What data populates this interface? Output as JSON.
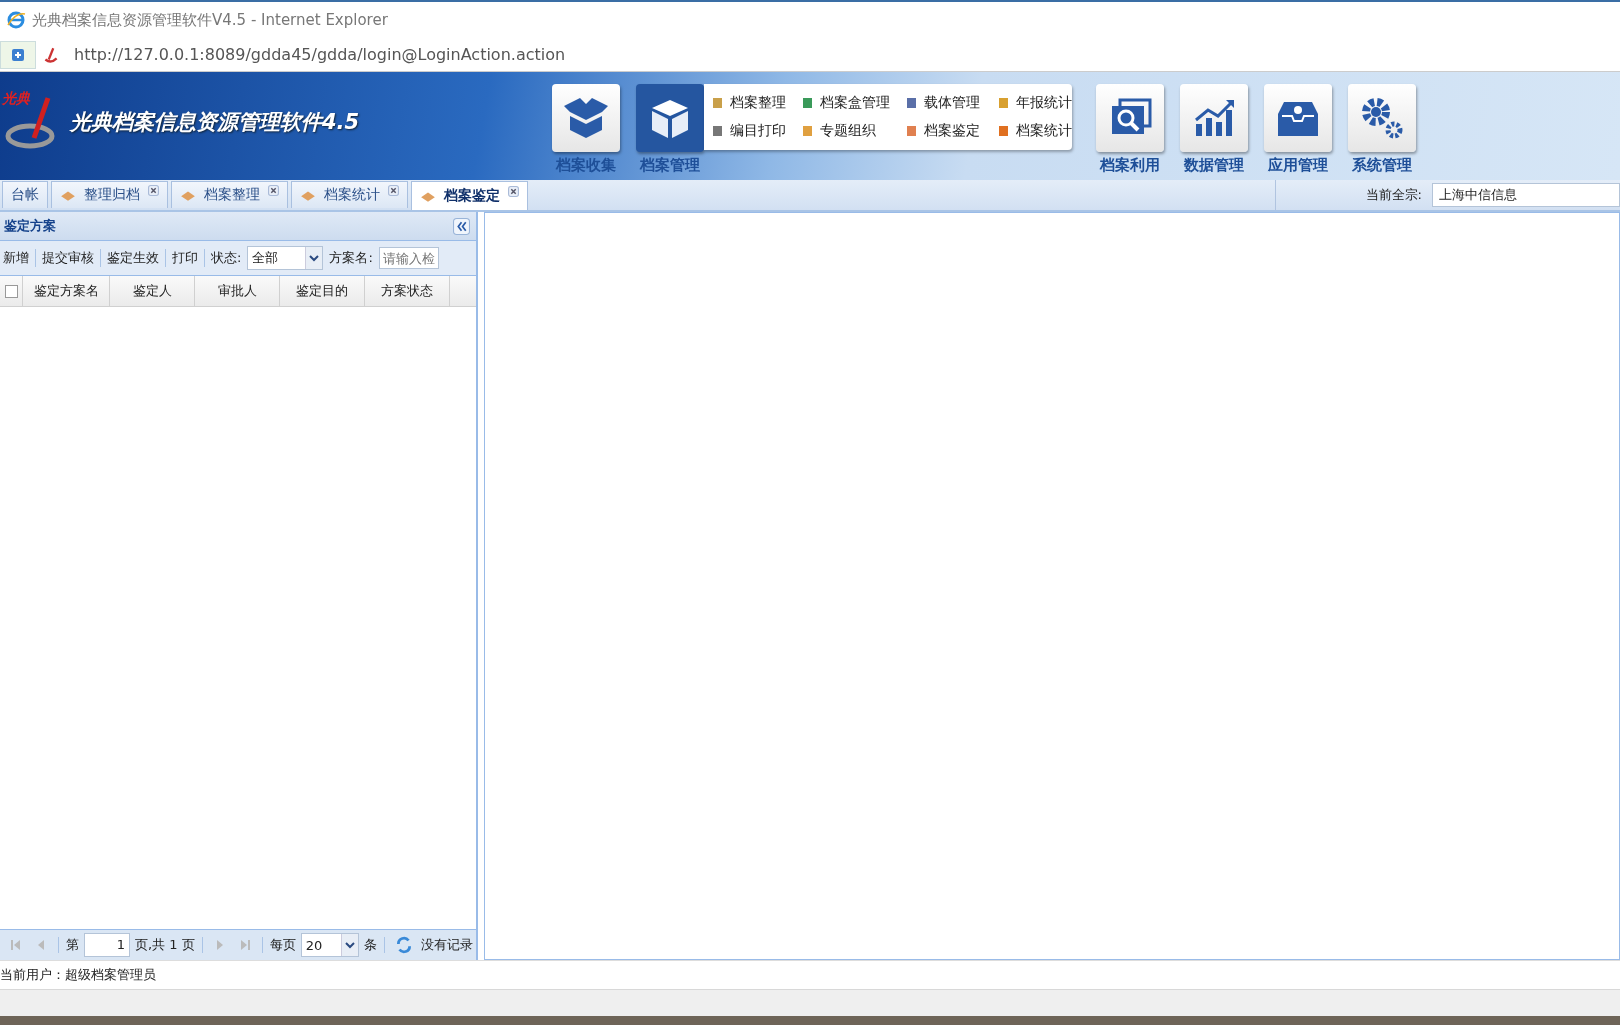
{
  "window": {
    "title": "光典档案信息资源管理软件V4.5 - Internet Explorer"
  },
  "address_bar": {
    "url": "http://127.0.0.1:8089/gdda45/gdda/login@LoginAction.action"
  },
  "header": {
    "logo_text": "光典",
    "app_title": "光典档案信息资源管理软件4.5",
    "modules": [
      {
        "label": "档案收集",
        "selected": false
      },
      {
        "label": "档案管理",
        "selected": true
      },
      {
        "label": "档案利用",
        "selected": false
      },
      {
        "label": "数据管理",
        "selected": false
      },
      {
        "label": "应用管理",
        "selected": false
      },
      {
        "label": "系统管理",
        "selected": false
      }
    ],
    "submenu": [
      {
        "label": "档案整理"
      },
      {
        "label": "档案盒管理"
      },
      {
        "label": "载体管理"
      },
      {
        "label": "年报统计"
      },
      {
        "label": "编目打印"
      },
      {
        "label": "专题组织"
      },
      {
        "label": "档案鉴定"
      },
      {
        "label": "档案统计"
      }
    ]
  },
  "tabs": [
    {
      "label": "台帐",
      "selected": false,
      "closable": false
    },
    {
      "label": "整理归档",
      "selected": false,
      "closable": true
    },
    {
      "label": "档案整理",
      "selected": false,
      "closable": true
    },
    {
      "label": "档案统计",
      "selected": false,
      "closable": true
    },
    {
      "label": "档案鉴定",
      "selected": true,
      "closable": true
    }
  ],
  "fonds_selector": {
    "label": "当前全宗:",
    "value": "上海中信信息"
  },
  "panel": {
    "title": "鉴定方案",
    "toolbar": [
      "新增",
      "提交审核",
      "鉴定生效",
      "打印"
    ],
    "status_filter": {
      "label": "状态:",
      "value": "全部"
    },
    "name_filter": {
      "label": "方案名:",
      "placeholder": "请输入检"
    },
    "table": {
      "select_all_checked": false,
      "columns": [
        "鉴定方案名",
        "鉴定人",
        "审批人",
        "鉴定目的",
        "方案状态"
      ]
    },
    "pager": {
      "page_prefix": "第",
      "page_value": "1",
      "page_suffix": "页,共 1 页",
      "per_page_label": "每页",
      "per_page_value": "20",
      "per_page_suffix": "条",
      "message": "没有记录"
    }
  },
  "status_bar": {
    "user": "当前用户：超级档案管理员"
  }
}
